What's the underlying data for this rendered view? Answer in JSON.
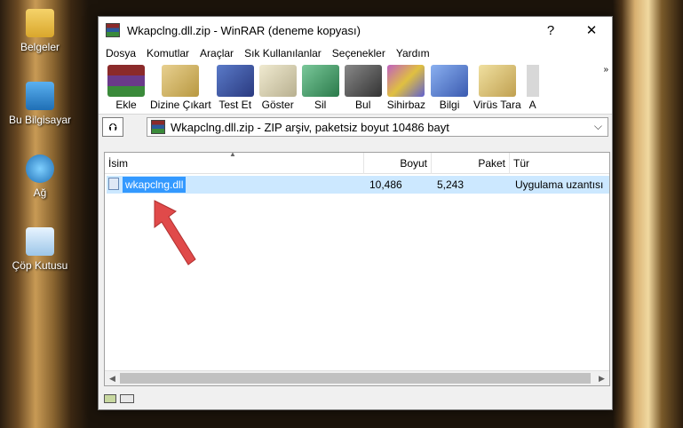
{
  "desktop": {
    "icons": [
      {
        "label": "Belgeler"
      },
      {
        "label": "Bu Bilgisayar"
      },
      {
        "label": "Ağ"
      },
      {
        "label": "Çöp Kutusu"
      }
    ]
  },
  "window": {
    "title": "Wkapclng.dll.zip - WinRAR (deneme kopyası)",
    "help_label": "?",
    "close_label": "✕"
  },
  "menu": {
    "items": [
      "Dosya",
      "Komutlar",
      "Araçlar",
      "Sık Kullanılanlar",
      "Seçenekler",
      "Yardım"
    ]
  },
  "toolbar": {
    "items": [
      {
        "label": "Ekle",
        "icon": "add-icon",
        "color": "#6a3a8a"
      },
      {
        "label": "Dizine Çıkart",
        "icon": "extract-icon",
        "color": "#c8b060"
      },
      {
        "label": "Test Et",
        "icon": "test-icon",
        "color": "#3a5aa0"
      },
      {
        "label": "Göster",
        "icon": "view-icon",
        "color": "#d8d0b0"
      },
      {
        "label": "Sil",
        "icon": "delete-icon",
        "color": "#4a9a6a"
      },
      {
        "label": "Bul",
        "icon": "find-icon",
        "color": "#555555"
      },
      {
        "label": "Sihirbaz",
        "icon": "wizard-icon",
        "color": "#8a3a8a"
      },
      {
        "label": "Bilgi",
        "icon": "info-icon",
        "color": "#4a6ab0"
      },
      {
        "label": "Virüs Tara",
        "icon": "virus-scan-icon",
        "color": "#d8c080"
      },
      {
        "label": "A",
        "icon": "comment-icon",
        "color": "#c0c0c0"
      }
    ],
    "more": "»"
  },
  "address": {
    "up_label": "⮉",
    "path": "Wkapclng.dll.zip - ZIP arşiv, paketsiz boyut 10486 bayt",
    "dropdown": "⌵"
  },
  "columns": [
    "İsim",
    "Boyut",
    "Paket",
    "Tür"
  ],
  "files": [
    {
      "name": "wkapclng.dll",
      "size": "10,486",
      "packed": "5,243",
      "type": "Uygulama uzantısı"
    }
  ],
  "colors": {
    "selection": "#3399ff",
    "selection_row": "#cce8ff",
    "arrow": "#e04a4a"
  }
}
